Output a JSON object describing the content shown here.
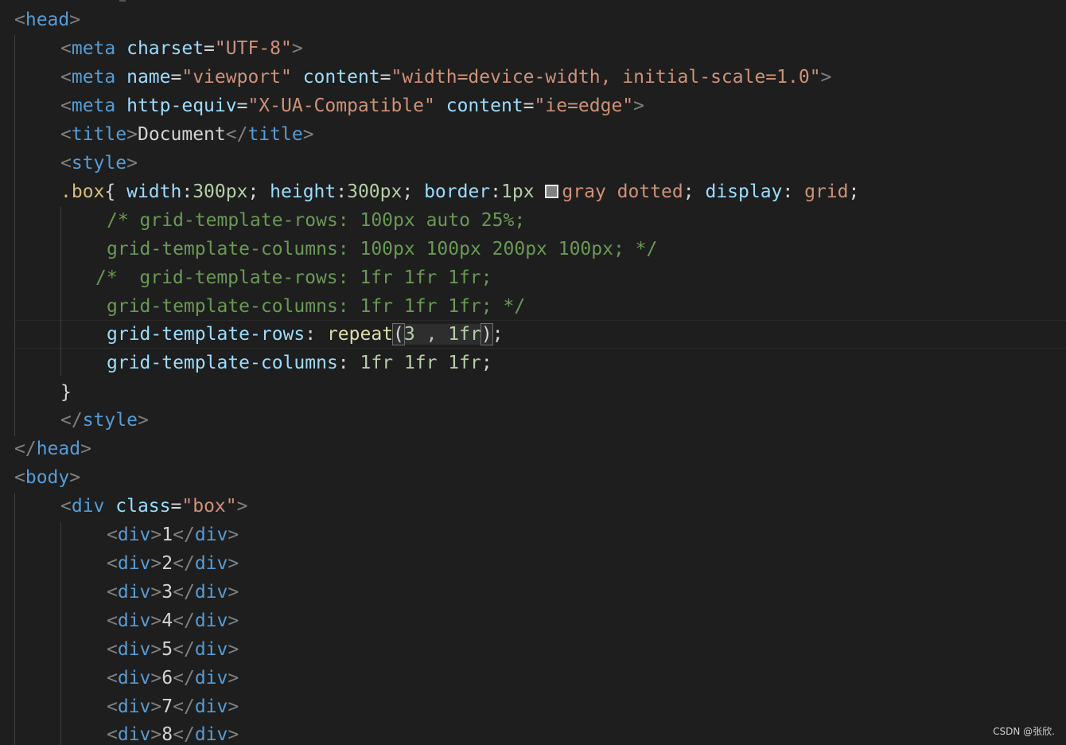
{
  "editor": {
    "watermark": "CSDN @张欣.",
    "colors": {
      "background": "#1e1e1e",
      "tag": "#569cd6",
      "attribute": "#9cdcfe",
      "string": "#ce9178",
      "comment": "#6a9955",
      "number": "#b5cea8",
      "function": "#dcdcaa",
      "selector": "#d7ba7d"
    },
    "lines": {
      "l1": {
        "t1": "<",
        "t2": "head",
        "t3": ">"
      },
      "l2": {
        "t1": "<",
        "t2": "meta",
        "t3": " ",
        "t4": "charset",
        "t5": "=",
        "t6": "\"UTF-8\"",
        "t7": ">"
      },
      "l3": {
        "t1": "<",
        "t2": "meta",
        "t3": " ",
        "t4": "name",
        "t5": "=",
        "t6": "\"viewport\"",
        "t7": " ",
        "t8": "content",
        "t9": "=",
        "t10": "\"width=device-width, initial-scale=1.0\"",
        "t11": ">"
      },
      "l4": {
        "t1": "<",
        "t2": "meta",
        "t3": " ",
        "t4": "http-equiv",
        "t5": "=",
        "t6": "\"X-UA-Compatible\"",
        "t7": " ",
        "t8": "content",
        "t9": "=",
        "t10": "\"ie=edge\"",
        "t11": ">"
      },
      "l5": {
        "t1": "<",
        "t2": "title",
        "t3": ">",
        "t4": "Document",
        "t5": "</",
        "t6": "title",
        "t7": ">"
      },
      "l6": {
        "t1": "<",
        "t2": "style",
        "t3": ">"
      },
      "l7": {
        "t1": ".box",
        "t2": "{ ",
        "t3": "width",
        "t4": ":",
        "t5": "300px",
        "t6": "; ",
        "t7": "height",
        "t8": ":",
        "t9": "300px",
        "t10": "; ",
        "t11": "border",
        "t12": ":",
        "t13": "1px",
        "t14": " ",
        "t15": "gray",
        "t16": " ",
        "t17": "dotted",
        "t18": "; ",
        "t19": "display",
        "t20": ": ",
        "t21": "grid",
        "t22": ";"
      },
      "l8": {
        "t1": "/* grid-template-rows: 100px auto 25%;"
      },
      "l9": {
        "t1": "grid-template-columns: 100px 100px 200px 100px; */"
      },
      "l10": {
        "t1": "/*  grid-template-rows: 1fr 1fr 1fr;"
      },
      "l11": {
        "t1": "grid-template-columns: 1fr 1fr 1fr; */"
      },
      "l12": {
        "t1": "grid-template-rows",
        "t2": ": ",
        "t3": "repeat",
        "t4": "(",
        "t5": "3 , 1fr",
        "t6": ")",
        "t7": ";"
      },
      "l13": {
        "t1": "grid-template-columns",
        "t2": ": ",
        "t3": "1fr 1fr 1fr",
        "t4": ";"
      },
      "l14": {
        "t1": "}"
      },
      "l15": {
        "t1": "</",
        "t2": "style",
        "t3": ">"
      },
      "l16": {
        "t1": "</",
        "t2": "head",
        "t3": ">"
      },
      "l17": {
        "t1": "<",
        "t2": "body",
        "t3": ">"
      },
      "l18": {
        "t1": "<",
        "t2": "div",
        "t3": " ",
        "t4": "class",
        "t5": "=",
        "t6": "\"box\"",
        "t7": ">"
      },
      "l19": {
        "t1": "<",
        "t2": "div",
        "t3": ">",
        "t4": "1",
        "t5": "</",
        "t6": "div",
        "t7": ">"
      },
      "l20": {
        "t1": "<",
        "t2": "div",
        "t3": ">",
        "t4": "2",
        "t5": "</",
        "t6": "div",
        "t7": ">"
      },
      "l21": {
        "t1": "<",
        "t2": "div",
        "t3": ">",
        "t4": "3",
        "t5": "</",
        "t6": "div",
        "t7": ">"
      },
      "l22": {
        "t1": "<",
        "t2": "div",
        "t3": ">",
        "t4": "4",
        "t5": "</",
        "t6": "div",
        "t7": ">"
      },
      "l23": {
        "t1": "<",
        "t2": "div",
        "t3": ">",
        "t4": "5",
        "t5": "</",
        "t6": "div",
        "t7": ">"
      },
      "l24": {
        "t1": "<",
        "t2": "div",
        "t3": ">",
        "t4": "6",
        "t5": "</",
        "t6": "div",
        "t7": ">"
      },
      "l25": {
        "t1": "<",
        "t2": "div",
        "t3": ">",
        "t4": "7",
        "t5": "</",
        "t6": "div",
        "t7": ">"
      },
      "l26": {
        "t1": "<",
        "t2": "div",
        "t3": ">",
        "t4": "8",
        "t5": "</",
        "t6": "div",
        "t7": ">"
      }
    }
  }
}
